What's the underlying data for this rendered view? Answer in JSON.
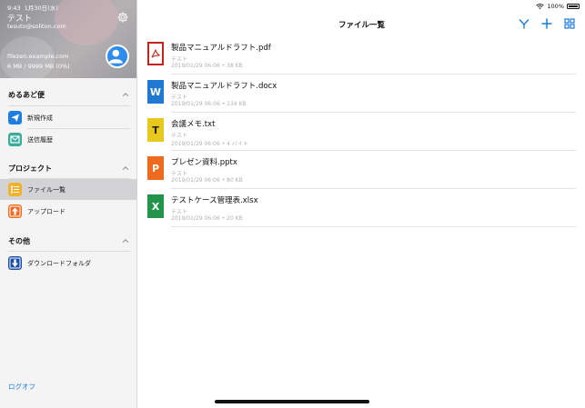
{
  "status": {
    "time": "9:43",
    "date": "1月30日(水)",
    "battery": "100%"
  },
  "header": {
    "user_name": "テスト",
    "user_email": "tesuto@soliton.com",
    "server": "filezen.example.com",
    "quota": "6 MB / 9999 MB (0%)"
  },
  "sidebar": {
    "sections": [
      {
        "title": "めるあど便",
        "items": [
          {
            "label": "新規作成",
            "icon": "paper-plane-icon",
            "color": "#1f7fe0"
          },
          {
            "label": "送信履歴",
            "icon": "mail-history-icon",
            "color": "#3bab9b"
          }
        ]
      },
      {
        "title": "プロジェクト",
        "items": [
          {
            "label": "ファイル一覧",
            "icon": "file-list-icon",
            "color": "#f0b22a",
            "active": true
          },
          {
            "label": "アップロード",
            "icon": "upload-icon",
            "color": "#ef6c22"
          }
        ]
      },
      {
        "title": "その他",
        "items": [
          {
            "label": "ダウンロードフォルダ",
            "icon": "download-folder-icon",
            "color": "#1e4fa8"
          }
        ]
      }
    ],
    "logout": "ログオフ"
  },
  "main": {
    "title": "ファイル一覧",
    "files": [
      {
        "name": "製品マニュアルドラフト.pdf",
        "sub": "テスト",
        "meta": "2019/01/29 06:06 • 38 KB",
        "icon_letter": "",
        "icon": "pdf-icon",
        "color": "#c4241b"
      },
      {
        "name": "製品マニュアルドラフト.docx",
        "sub": "テスト",
        "meta": "2019/01/29 06:06 • 134 KB",
        "icon_letter": "W",
        "icon": "word-icon",
        "color": "#1f78d1"
      },
      {
        "name": "会議メモ.txt",
        "sub": "テスト",
        "meta": "2019/01/29 06:06 • 4 バイト",
        "icon_letter": "T",
        "icon": "text-icon",
        "color": "#e9c81e"
      },
      {
        "name": "プレゼン資料.pptx",
        "sub": "テスト",
        "meta": "2019/01/29 06:06 • 80 KB",
        "icon_letter": "P",
        "icon": "powerpoint-icon",
        "color": "#ef6a1f"
      },
      {
        "name": "テストケース管理表.xlsx",
        "sub": "テスト",
        "meta": "2019/01/29 06:06 • 20 KB",
        "icon_letter": "X",
        "icon": "excel-icon",
        "color": "#22954a"
      }
    ]
  },
  "colors": {
    "accent": "#1b7ad8",
    "active_item_bg": "#d3d3d6"
  }
}
